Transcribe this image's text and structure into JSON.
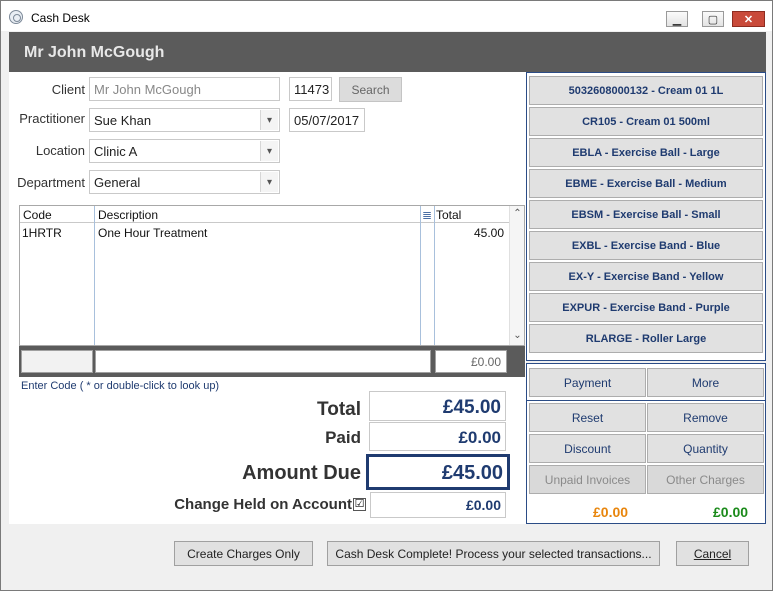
{
  "window": {
    "title": "Cash Desk",
    "minimize": "▁",
    "maximize": "▢",
    "close": "✕"
  },
  "banner": {
    "name": "Mr John McGough"
  },
  "form": {
    "client_label": "Client",
    "client_value": "Mr John McGough",
    "client_id": "11473",
    "search_label": "Search",
    "practitioner_label": "Practitioner",
    "practitioner_value": "Sue Khan",
    "date_value": "05/07/2017",
    "location_label": "Location",
    "location_value": "Clinic A",
    "department_label": "Department",
    "department_value": "General"
  },
  "grid": {
    "headers": {
      "code": "Code",
      "description": "Description",
      "total": "Total"
    },
    "rows": [
      {
        "code": "1HRTR",
        "description": "One Hour Treatment",
        "total": "45.00"
      }
    ],
    "entry_total": "£0.00",
    "hint": "Enter Code ( * or double-click to look up)"
  },
  "summary": {
    "total_label": "Total",
    "total_value": "£45.00",
    "paid_label": "Paid",
    "paid_value": "£0.00",
    "due_label": "Amount Due",
    "due_value": "£45.00",
    "change_label": "Change Held on Account",
    "change_checked": "☑",
    "change_value": "£0.00"
  },
  "products": [
    "5032608000132 - Cream 01 1L",
    "CR105 - Cream 01 500ml",
    "EBLA - Exercise Ball - Large",
    "EBME - Exercise Ball - Medium",
    "EBSM - Exercise Ball - Small",
    "EXBL - Exercise Band - Blue",
    "EX-Y - Exercise Band - Yellow",
    "EXPUR - Exercise Band - Purple",
    "RLARGE - Roller Large"
  ],
  "actions": {
    "payment": "Payment",
    "more": "More",
    "reset": "Reset",
    "remove": "Remove",
    "discount": "Discount",
    "quantity": "Quantity",
    "unpaid_invoices": "Unpaid Invoices",
    "other_charges": "Other Charges",
    "balance_orange": "£0.00",
    "balance_green": "£0.00",
    "balance_orange_color": "#e8850c",
    "balance_green_color": "#1a8a1a"
  },
  "footer": {
    "create_charges": "Create Charges Only",
    "complete": "Cash Desk Complete! Process your selected transactions...",
    "cancel": "Cancel"
  }
}
